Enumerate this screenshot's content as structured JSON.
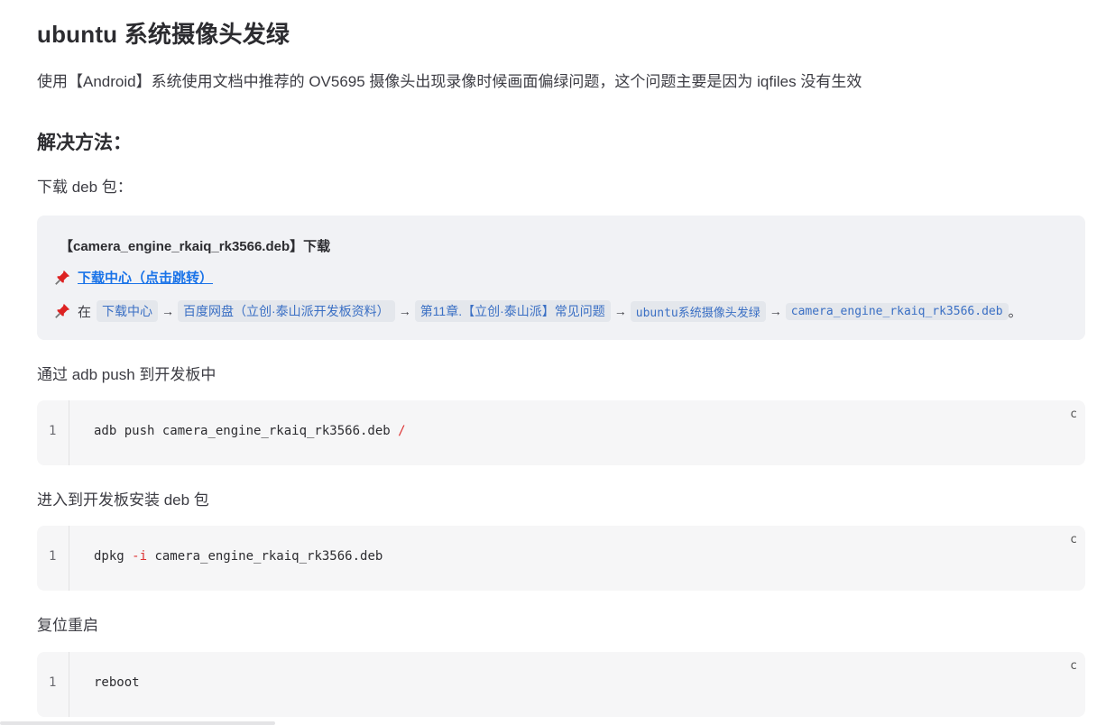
{
  "title": "ubuntu 系统摄像头发绿",
  "intro": "使用【Android】系统使用文档中推荐的 OV5695 摄像头出现录像时候画面偏绿问题，这个问题主要是因为 iqfiles 没有生效",
  "solution_heading": "解决方法：",
  "download_text": "下载 deb 包：",
  "tip": {
    "title": "【camera_engine_rkaiq_rk3566.deb】下载",
    "link": "下载中心（点击跳转）",
    "path_prefix": "在",
    "crumbs": [
      "下载中心",
      "百度网盘（立创·泰山派开发板资料）",
      "第11章.【立创·泰山派】常见问题",
      "ubuntu系统摄像头发绿",
      "camera_engine_rkaiq_rk3566.deb"
    ],
    "arrow": "→",
    "path_suffix": "。"
  },
  "push_text": "通过 adb push 到开发板中",
  "code1": {
    "line": "1",
    "text": "adb push camera_engine_rkaiq_rk3566.deb ",
    "highlight": "/",
    "copy": "c"
  },
  "install_text": "进入到开发板安装 deb 包",
  "code2": {
    "line": "1",
    "pre": "dpkg ",
    "highlight": "-i",
    "text": " camera_engine_rkaiq_rk3566.deb",
    "copy": "c"
  },
  "reboot_text": "复位重启",
  "code3": {
    "line": "1",
    "text": "reboot",
    "copy": "c"
  }
}
